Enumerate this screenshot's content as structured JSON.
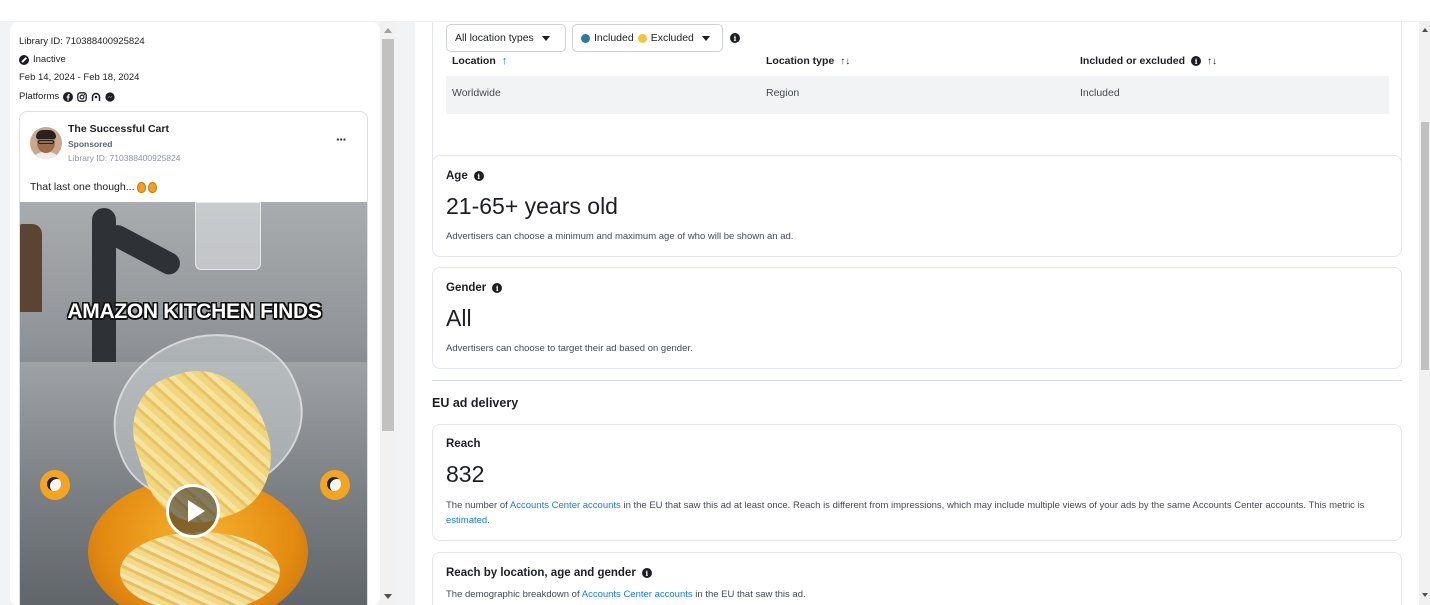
{
  "ad_meta": {
    "library_id": "Library ID: 710388400925824",
    "status": "Inactive",
    "date_range": "Feb 14, 2024 - Feb 18, 2024",
    "platforms_label": "Platforms",
    "platforms": [
      "facebook-icon",
      "instagram-icon",
      "audience-network-icon",
      "messenger-icon"
    ]
  },
  "ad_preview": {
    "page_name": "The Successful Cart",
    "sponsored": "Sponsored",
    "library_id": "Library ID: 710388400925824",
    "more": "···",
    "body_text": "That last one though...",
    "video_caption": "AMAZON KITCHEN FINDS"
  },
  "location": {
    "filter_type": "All location types",
    "filter_included": "Included",
    "filter_excluded": "Excluded",
    "columns": [
      "Location",
      "Location type",
      "Included or excluded"
    ],
    "rows": [
      {
        "location": "Worldwide",
        "type": "Region",
        "included": "Included"
      }
    ]
  },
  "age": {
    "title": "Age",
    "value": "21-65+ years old",
    "desc": "Advertisers can choose a minimum and maximum age of who will be shown an ad."
  },
  "gender": {
    "title": "Gender",
    "value": "All",
    "desc": "Advertisers can choose to target their ad based on gender."
  },
  "eu": {
    "section_title": "EU ad delivery",
    "reach_title": "Reach",
    "reach_value": "832",
    "reach_desc_1": "The number of ",
    "reach_link_1": "Accounts Center accounts",
    "reach_desc_2": " in the EU that saw this ad at least once. Reach is different from impressions, which may include multiple views of your ads by the same Accounts Center accounts. This metric is ",
    "reach_link_2": "estimated",
    "reach_desc_3": ".",
    "rbl_title": "Reach by location, age and gender",
    "rbl_desc_1": "The demographic breakdown of ",
    "rbl_link": "Accounts Center accounts",
    "rbl_desc_2": " in the EU that saw this ad."
  },
  "colors": {
    "link": "#1877f2",
    "text": "#1c1e21",
    "muted": "#444950",
    "card_border": "#e4e6eb",
    "row_bg": "#f2f3f5"
  }
}
